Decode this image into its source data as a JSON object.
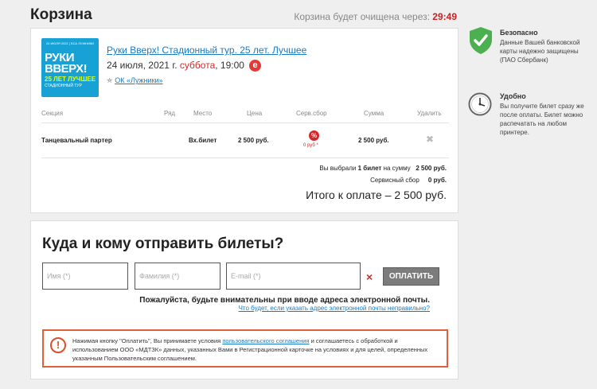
{
  "header": {
    "title": "Корзина",
    "timer_label": "Корзина будет очищена через:",
    "timer_value": "29:49"
  },
  "event": {
    "poster": {
      "top_text": "24 ИЮЛЯ 2021 | БСА ЛУЖНИКИ",
      "line1": "РУКИ",
      "line2": "ВВЕРХ!",
      "line3": "25 ЛЕТ ЛУЧШЕЕ",
      "line4": "СТАДИОННЫЙ ТУР"
    },
    "title": "Руки Вверх! Стадионный тур. 25 лет. Лучшее",
    "date": "24 июля, 2021 г.",
    "weekday": "суббота",
    "time": ", 19:00",
    "venue": "ОК «Лужники»",
    "logo_icon": "e-logo-icon"
  },
  "table": {
    "headers": {
      "section": "Секция",
      "row": "Ряд",
      "seat": "Место",
      "price": "Цена",
      "fee": "Серв.сбор",
      "sum": "Сумма",
      "delete": "Удалить"
    },
    "rows": [
      {
        "section": "Танцевальный партер",
        "row": "",
        "seat": "Вх.билет",
        "price": "2 500 руб.",
        "fee_icon": "%",
        "fee": "0 руб *",
        "sum": "2 500 руб."
      }
    ]
  },
  "summary": {
    "selected_prefix": "Вы выбрали",
    "selected_count": "1 билет",
    "selected_suffix": "на сумму",
    "selected_amount": "2 500 руб.",
    "fee_label": "Сервисный сбор",
    "fee_amount": "0 руб.",
    "total": "Итого к оплате – 2 500 руб."
  },
  "delivery": {
    "title": "Куда и кому отправить билеты?",
    "name_placeholder": "Имя (*)",
    "surname_placeholder": "Фамилия (*)",
    "email_placeholder": "E-mail (*)",
    "clear_mark": "×",
    "pay_button": "ОПЛАТИТЬ",
    "warning": "Пожалуйста, будьте внимательны при вводе адреса электронной почты.",
    "warning_link": "Что будет, если указать адрес электронной почты неправильно?"
  },
  "agreement": {
    "icon": "!",
    "text_before": "Нажимая кнопку \"Оплатить\", Вы принимаете условия ",
    "link": "пользовательского соглашения",
    "text_after": " и соглашаетесь с обработкой и использованием ООО «МДТЗК» данных, указанных Вами в Регистрационной карточке на условиях и для целей, определенных указанным Пользовательским соглашением."
  },
  "sidebar": {
    "safe": {
      "icon": "shield-check-icon",
      "title": "Безопасно",
      "text": "Данные Вашей банковской карты надежно защищены (ПАО Сбербанк)"
    },
    "convenient": {
      "icon": "clock-icon",
      "title": "Удобно",
      "text": "Вы получите билет сразу же после оплаты. Билет можно распечатать на любом принтере."
    }
  },
  "colors": {
    "accent_red": "#cc1f1f",
    "link_blue": "#1a7ac4",
    "shield_green": "#4caf50",
    "warning_orange": "#e0603a"
  }
}
